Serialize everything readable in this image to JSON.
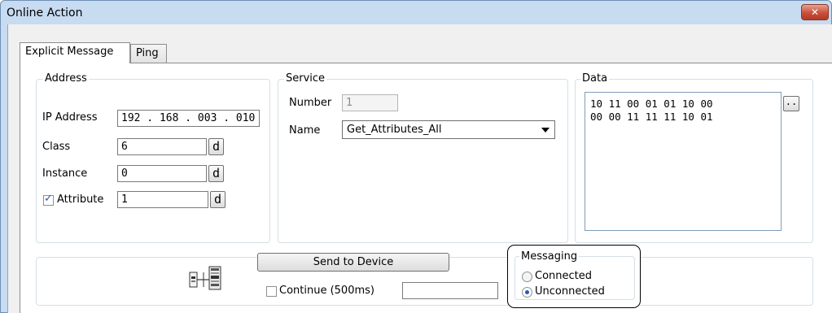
{
  "window": {
    "title": "Online Action",
    "close_glyph": "✕"
  },
  "tabs": [
    {
      "label": "Explicit Message",
      "active": true
    },
    {
      "label": "Ping",
      "active": false
    }
  ],
  "address": {
    "group_label": "Address",
    "ip_label": "IP Address",
    "ip_value": "192 . 168 . 003 . 010",
    "class_label": "Class",
    "class_value": "6",
    "instance_label": "Instance",
    "instance_value": "0",
    "attribute_label": "Attribute",
    "attribute_checked": true,
    "attribute_value": "1",
    "radix_button_label": "d"
  },
  "service": {
    "group_label": "Service",
    "number_label": "Number",
    "number_value": "1",
    "name_label": "Name",
    "name_value": "Get_Attributes_All"
  },
  "data": {
    "group_label": "Data",
    "hex_value": "10 11 00 01 01 10 00\n00 00 11 11 11 10 01",
    "browse_label": ".."
  },
  "actions": {
    "send_button_label": "Send to Device",
    "continue_label": "Continue (500ms)",
    "continue_checked": false,
    "continue_value": ""
  },
  "messaging": {
    "group_label": "Messaging",
    "options": [
      {
        "label": "Connected",
        "checked": false
      },
      {
        "label": "Unconnected",
        "checked": true
      }
    ]
  },
  "icons": {
    "device": "network-device-icon",
    "close": "close-icon",
    "checkmark": "checkmark-icon"
  },
  "colors": {
    "title_bar": "#c7dbf1",
    "close_button": "#c9503a",
    "radio_selected": "#1f5db8"
  }
}
